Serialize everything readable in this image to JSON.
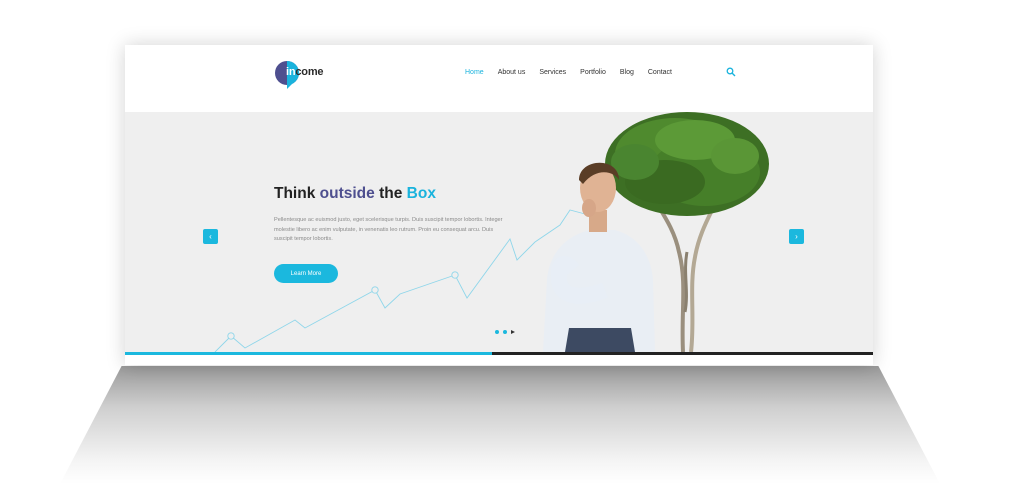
{
  "brand": {
    "logo_prefix": "in",
    "logo_suffix": "come",
    "accent_color": "#1ab3dd",
    "secondary_color": "#4e4f8f"
  },
  "nav": {
    "items": [
      {
        "label": "Home",
        "active": true
      },
      {
        "label": "About us",
        "active": false
      },
      {
        "label": "Services",
        "active": false
      },
      {
        "label": "Portfolio",
        "active": false
      },
      {
        "label": "Blog",
        "active": false
      },
      {
        "label": "Contact",
        "active": false
      }
    ],
    "search_icon": "search-icon"
  },
  "hero": {
    "headline_1": "Think",
    "headline_2": "outside",
    "headline_3": "the",
    "headline_4": "Box",
    "body": "Pellentesque ac euismod justo, eget scelerisque turpis. Duis suscipit tempor lobortis. Integer molestie libero ac enim vulputate, in venenatis leo rutrum. Proin eu consequat arcu. Duis suscipit tempor lobortis.",
    "cta_label": "Learn More",
    "prev_icon": "‹",
    "next_icon": "›",
    "slide_progress": 0.49
  }
}
